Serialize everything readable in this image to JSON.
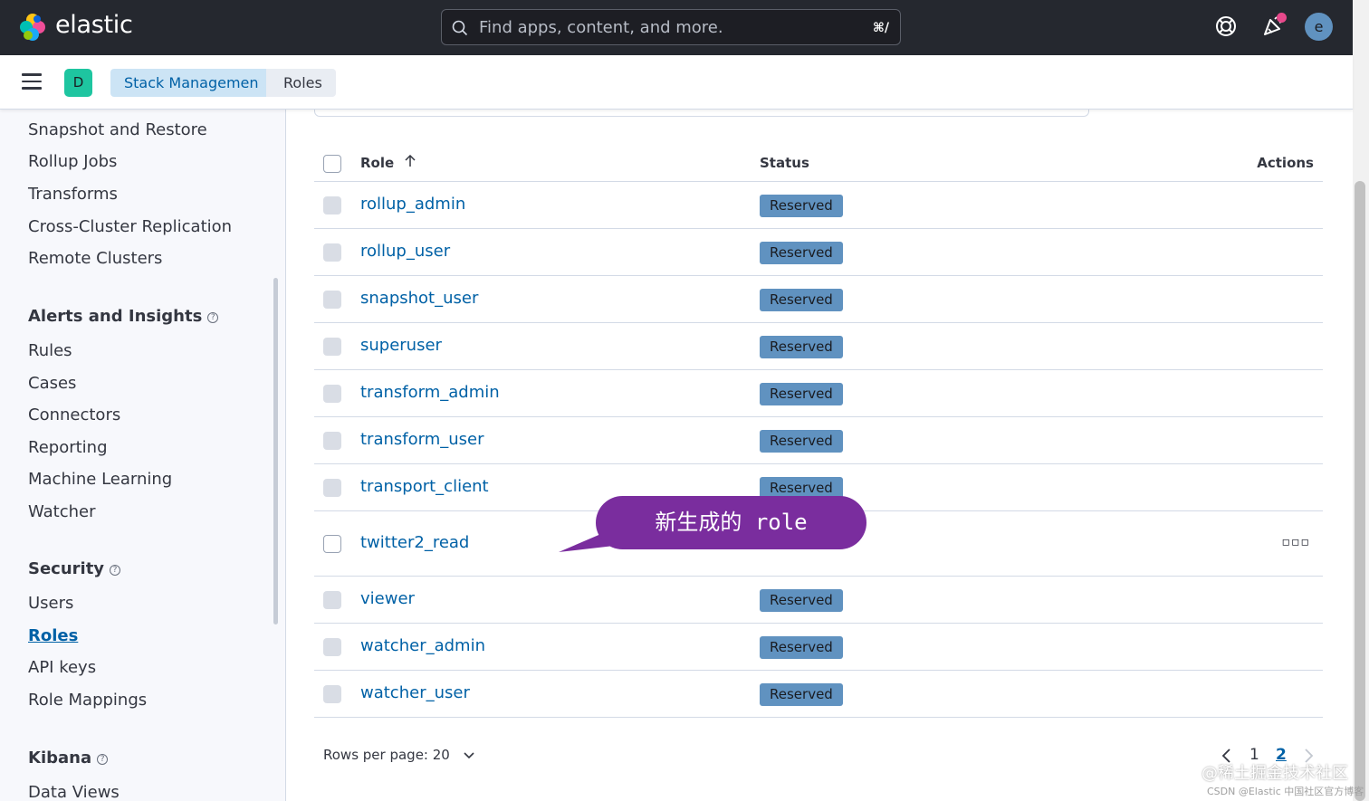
{
  "header": {
    "brand": "elastic",
    "search_placeholder": "Find apps, content, and more.",
    "search_shortcut": "⌘/",
    "avatar_initial": "e"
  },
  "subheader": {
    "space_initial": "D",
    "breadcrumbs": [
      "Stack Management",
      "Roles"
    ]
  },
  "sidebar": {
    "items_top": [
      "Snapshot and Restore",
      "Rollup Jobs",
      "Transforms",
      "Cross-Cluster Replication",
      "Remote Clusters"
    ],
    "sections": [
      {
        "title": "Alerts and Insights",
        "items": [
          "Rules",
          "Cases",
          "Connectors",
          "Reporting",
          "Machine Learning",
          "Watcher"
        ]
      },
      {
        "title": "Security",
        "items": [
          "Users",
          "Roles",
          "API keys",
          "Role Mappings"
        ]
      },
      {
        "title": "Kibana",
        "items": [
          "Data Views"
        ]
      }
    ],
    "active_item": "Roles"
  },
  "table": {
    "columns": [
      "Role",
      "Status",
      "Actions"
    ],
    "rows": [
      {
        "role": "rollup_admin",
        "status": "Reserved"
      },
      {
        "role": "rollup_user",
        "status": "Reserved"
      },
      {
        "role": "snapshot_user",
        "status": "Reserved"
      },
      {
        "role": "superuser",
        "status": "Reserved"
      },
      {
        "role": "transform_admin",
        "status": "Reserved"
      },
      {
        "role": "transform_user",
        "status": "Reserved"
      },
      {
        "role": "transport_client",
        "status": "Reserved"
      },
      {
        "role": "twitter2_read",
        "status": ""
      },
      {
        "role": "viewer",
        "status": "Reserved"
      },
      {
        "role": "watcher_admin",
        "status": "Reserved"
      },
      {
        "role": "watcher_user",
        "status": "Reserved"
      }
    ],
    "actions_glyph": "▫▫▫"
  },
  "footer": {
    "rows_per_page": "Rows per page: 20",
    "pages": [
      "1",
      "2"
    ],
    "current_page": "2"
  },
  "annotation": {
    "text": "新生成的 role"
  },
  "watermark": {
    "line1": "@稀土掘金技术社区",
    "line2": "CSDN @Elastic 中国社区官方博客"
  },
  "colors": {
    "header_bg": "#25282f",
    "link": "#0061a6",
    "badge": "#6092c0",
    "annotation": "#7a2d9e",
    "space_badge": "#1ec5a0"
  },
  "icons": [
    "elastic-logo-icon",
    "search-icon",
    "help-icon",
    "news-icon",
    "menu-icon",
    "sort-ascending-icon",
    "chevron-down-icon",
    "chevron-left-icon",
    "chevron-right-icon",
    "question-icon"
  ]
}
